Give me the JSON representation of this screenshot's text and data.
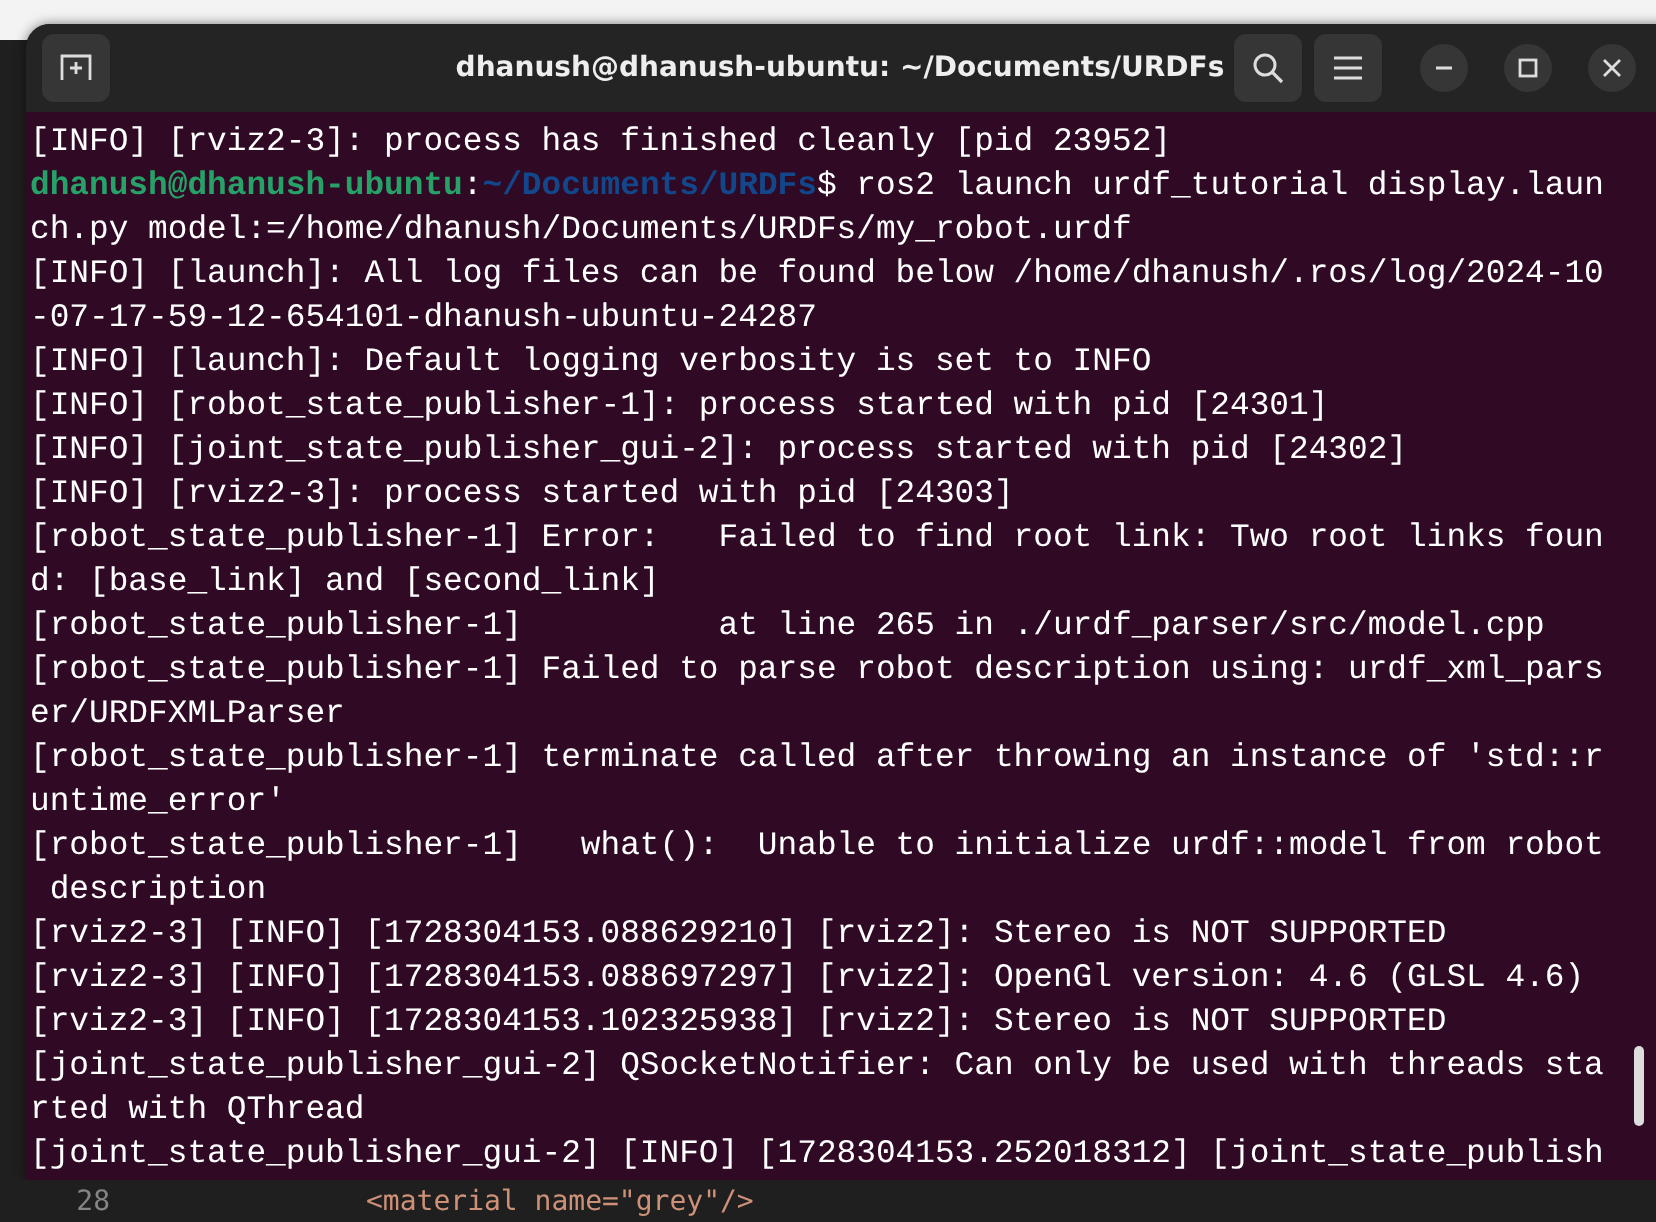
{
  "window": {
    "title": "dhanush@dhanush-ubuntu: ~/Documents/URDFs"
  },
  "terminal": {
    "lines": [
      {
        "kind": "text",
        "text": "[INFO] [rviz2-3]: process has finished cleanly [pid 23952]"
      },
      {
        "kind": "prompt",
        "user": "dhanush@dhanush-ubuntu",
        "sep": ":",
        "path": "~/Documents/URDFs",
        "text": "$ ros2 launch urdf_tutorial display.laun"
      },
      {
        "kind": "text",
        "text": "ch.py model:=/home/dhanush/Documents/URDFs/my_robot.urdf"
      },
      {
        "kind": "text",
        "text": "[INFO] [launch]: All log files can be found below /home/dhanush/.ros/log/2024-10"
      },
      {
        "kind": "text",
        "text": "-07-17-59-12-654101-dhanush-ubuntu-24287"
      },
      {
        "kind": "text",
        "text": "[INFO] [launch]: Default logging verbosity is set to INFO"
      },
      {
        "kind": "text",
        "text": "[INFO] [robot_state_publisher-1]: process started with pid [24301]"
      },
      {
        "kind": "text",
        "text": "[INFO] [joint_state_publisher_gui-2]: process started with pid [24302]"
      },
      {
        "kind": "text",
        "text": "[INFO] [rviz2-3]: process started with pid [24303]"
      },
      {
        "kind": "text",
        "text": "[robot_state_publisher-1] Error:   Failed to find root link: Two root links foun"
      },
      {
        "kind": "text",
        "text": "d: [base_link] and [second_link]"
      },
      {
        "kind": "text",
        "text": "[robot_state_publisher-1]          at line 265 in ./urdf_parser/src/model.cpp"
      },
      {
        "kind": "text",
        "text": "[robot_state_publisher-1] Failed to parse robot description using: urdf_xml_pars"
      },
      {
        "kind": "text",
        "text": "er/URDFXMLParser"
      },
      {
        "kind": "text",
        "text": "[robot_state_publisher-1] terminate called after throwing an instance of 'std::r"
      },
      {
        "kind": "text",
        "text": "untime_error'"
      },
      {
        "kind": "text",
        "text": "[robot_state_publisher-1]   what():  Unable to initialize urdf::model from robot"
      },
      {
        "kind": "text",
        "text": " description"
      },
      {
        "kind": "text",
        "text": "[rviz2-3] [INFO] [1728304153.088629210] [rviz2]: Stereo is NOT SUPPORTED"
      },
      {
        "kind": "text",
        "text": "[rviz2-3] [INFO] [1728304153.088697297] [rviz2]: OpenGl version: 4.6 (GLSL 4.6)"
      },
      {
        "kind": "text",
        "text": "[rviz2-3] [INFO] [1728304153.102325938] [rviz2]: Stereo is NOT SUPPORTED"
      },
      {
        "kind": "text",
        "text": "[joint_state_publisher_gui-2] QSocketNotifier: Can only be used with threads sta"
      },
      {
        "kind": "text",
        "text": "rted with QThread"
      },
      {
        "kind": "text",
        "text": "[joint_state_publisher_gui-2] [INFO] [1728304153.252018312] [joint_state_publish"
      }
    ]
  },
  "editor": {
    "lines": [
      {
        "number": "28",
        "code": "<material name=\"grey\"/>"
      }
    ]
  }
}
